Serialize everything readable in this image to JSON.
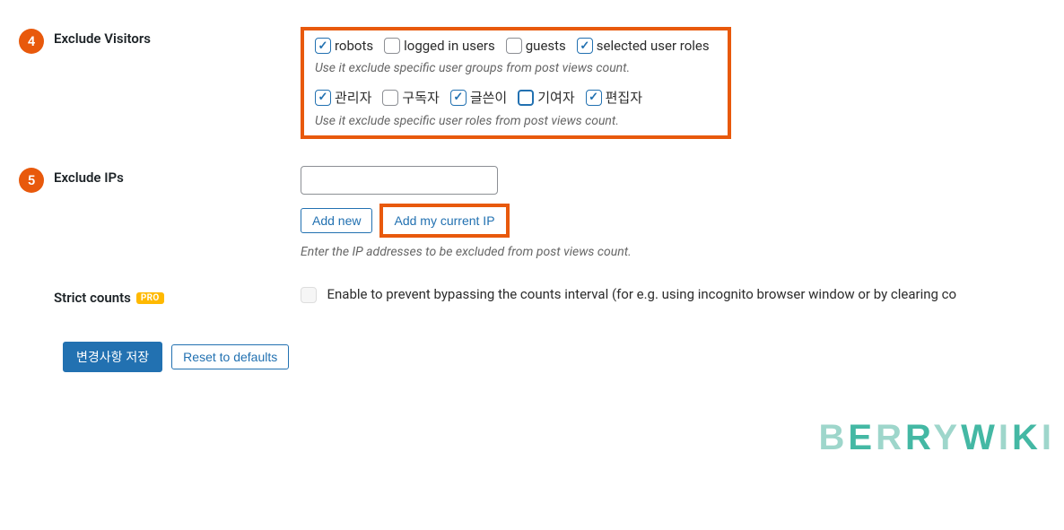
{
  "badges": {
    "item4": "4",
    "item5": "5"
  },
  "labels": {
    "exclude_visitors": "Exclude Visitors",
    "exclude_ips": "Exclude IPs",
    "strict_counts": "Strict counts",
    "pro": "PRO"
  },
  "visitors": {
    "groups": [
      {
        "label": "robots",
        "checked": true
      },
      {
        "label": "logged in users",
        "checked": false
      },
      {
        "label": "guests",
        "checked": false
      },
      {
        "label": "selected user roles",
        "checked": true
      }
    ],
    "groups_desc": "Use it exclude specific user groups from post views count.",
    "roles": [
      {
        "label": "관리자",
        "checked": true
      },
      {
        "label": "구독자",
        "checked": false
      },
      {
        "label": "글쓴이",
        "checked": true
      },
      {
        "label": "기여자",
        "checked": false,
        "focused": true
      },
      {
        "label": "편집자",
        "checked": true
      }
    ],
    "roles_desc": "Use it exclude specific user roles from post views count."
  },
  "ips": {
    "input_value": "",
    "add_new": "Add new",
    "add_current": "Add my current IP",
    "desc": "Enter the IP addresses to be excluded from post views count."
  },
  "strict": {
    "text": "Enable to prevent bypassing the counts interval (for e.g. using incognito browser window or by clearing co"
  },
  "footer": {
    "save": "변경사항 저장",
    "reset": "Reset to defaults"
  },
  "watermark": "BERRYWIKI"
}
